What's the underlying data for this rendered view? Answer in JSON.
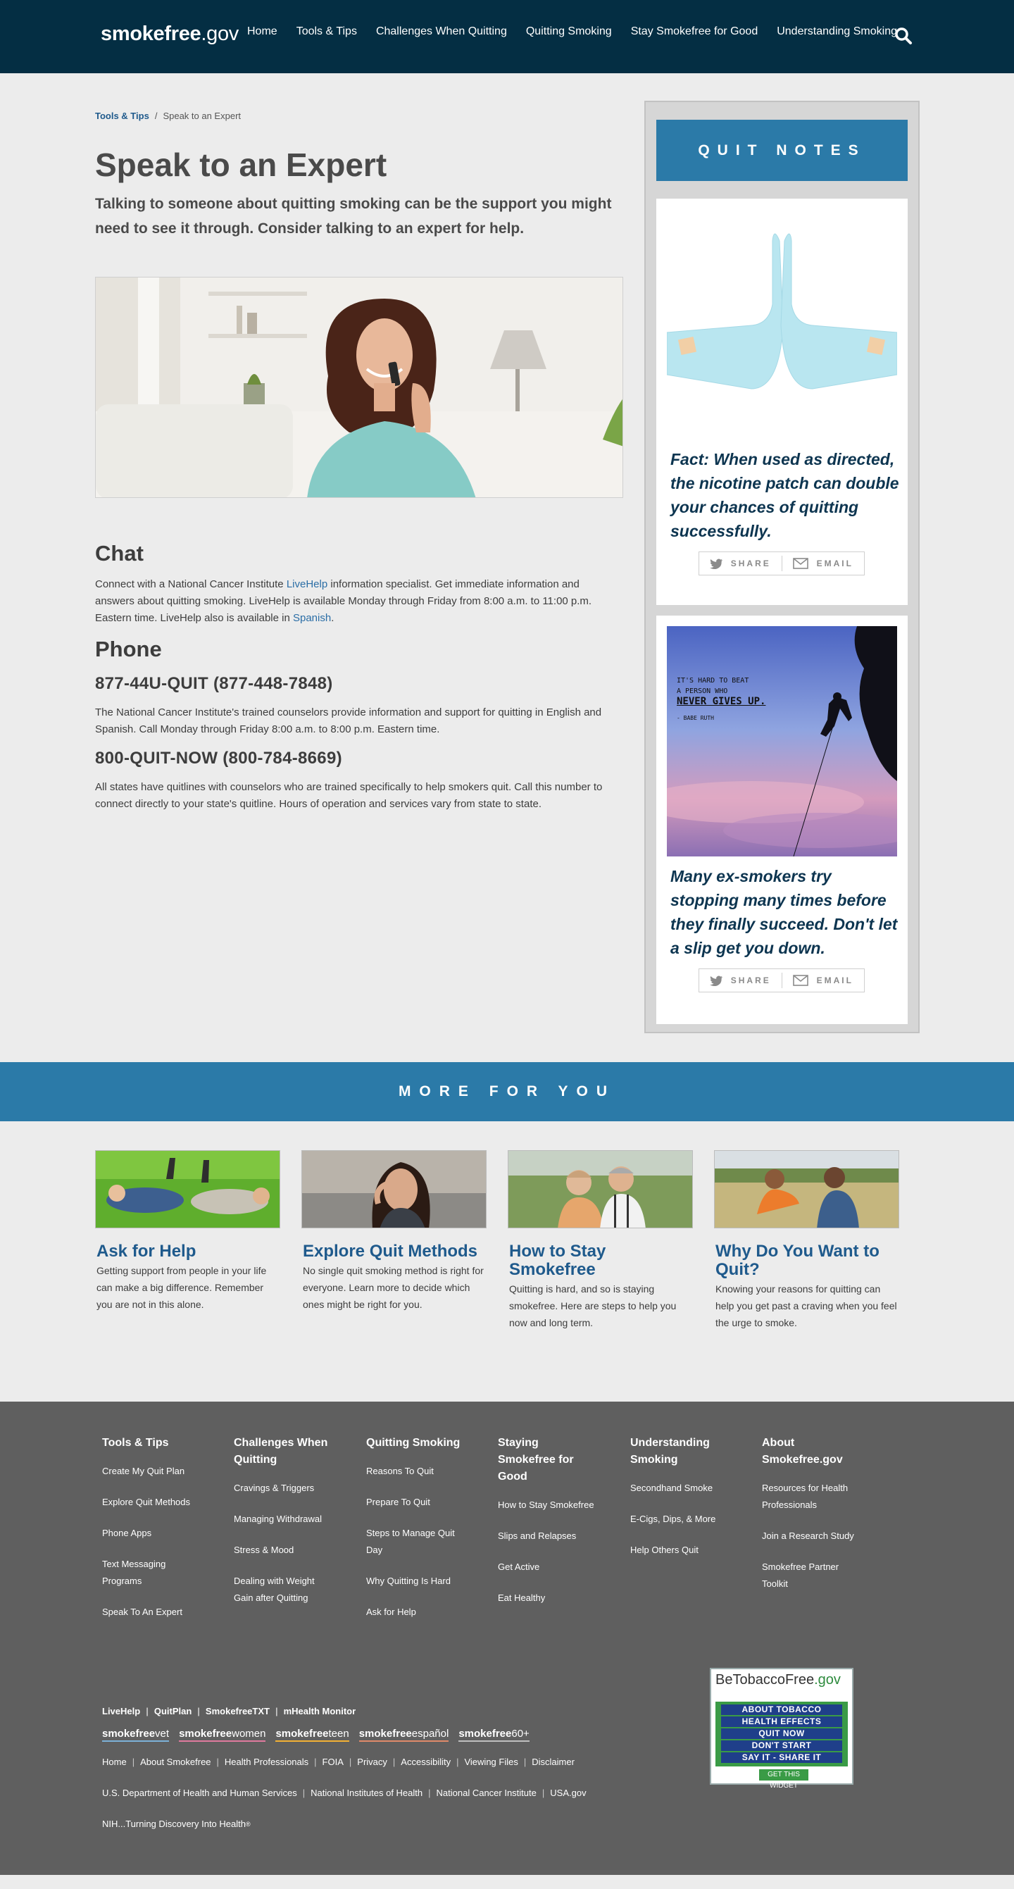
{
  "header": {
    "logo_main": "smokefree",
    "logo_suffix": ".gov",
    "nav": [
      "Home",
      "Tools & Tips",
      "Challenges When Quitting",
      "Quitting Smoking",
      "Stay Smokefree for Good",
      "Understanding Smoking"
    ]
  },
  "breadcrumb": {
    "parent": "Tools & Tips",
    "current": "Speak to an Expert"
  },
  "page": {
    "title": "Speak to an Expert",
    "lead": "Talking to someone about quitting smoking can be the support you might need to see it through. Consider talking to an expert for help."
  },
  "chat": {
    "heading": "Chat",
    "text1": "Connect with a National Cancer Institute ",
    "link1": "LiveHelp",
    "text2": " information specialist. Get immediate information and answers about quitting smoking. LiveHelp is available Monday through Friday from 8:00 a.m. to 11:00 p.m. Eastern time. LiveHelp also is available in ",
    "link2": "Spanish",
    "text3": "."
  },
  "phone": {
    "heading": "Phone",
    "number1": "877-44U-QUIT (877-448-7848)",
    "text1": "The National Cancer Institute's trained counselors provide information and support for quitting in English and Spanish. Call Monday through Friday 8:00 a.m. to 8:00 p.m. Eastern time.",
    "number2": "800-QUIT-NOW (800-784-8669)",
    "text2": "All states have quitlines with counselors who are trained specifically to help smokers quit. Call this number to connect directly to your state's quitline. Hours of operation and services vary from state to state."
  },
  "sidebar": {
    "heading": "QUIT NOTES",
    "notes": [
      {
        "text": "Fact: When used as directed, the nicotine patch can double your chances of quitting successfully."
      },
      {
        "text": "Many ex-smokers try stopping many times before they finally succeed. Don't let a slip get you down.",
        "image_quote": [
          "IT'S HARD TO BEAT",
          "A PERSON WHO",
          "NEVER GIVES UP.",
          "- BABE RUTH"
        ]
      }
    ],
    "share_label": "SHARE",
    "email_label": "EMAIL"
  },
  "more": {
    "heading": "MORE FOR YOU",
    "cards": [
      {
        "title": "Ask for Help",
        "text": "Getting support from people in your life can make a big difference. Remember you are not in this alone."
      },
      {
        "title": "Explore Quit Methods",
        "text": "No single quit smoking method is right for everyone. Learn more to decide which ones might be right for you."
      },
      {
        "title": "How to Stay Smokefree",
        "text": "Quitting is hard, and so is staying smokefree. Here are steps to help you now and long term."
      },
      {
        "title": "Why Do You Want to Quit?",
        "text": "Knowing your reasons for quitting can help you get past a craving when you feel the urge to smoke."
      }
    ]
  },
  "footer": {
    "columns": [
      {
        "heading": "Tools & Tips",
        "links": [
          "Create My Quit Plan",
          "Explore Quit Methods",
          "Phone Apps",
          "Text Messaging Programs",
          "Speak To An Expert"
        ]
      },
      {
        "heading": "Challenges When Quitting",
        "links": [
          "Cravings & Triggers",
          "Managing Withdrawal",
          "Stress & Mood",
          "Dealing with Weight Gain after Quitting"
        ]
      },
      {
        "heading": "Quitting Smoking",
        "links": [
          "Reasons To Quit",
          "Prepare To Quit",
          "Steps to Manage Quit Day",
          "Why Quitting Is Hard",
          "Ask for Help"
        ]
      },
      {
        "heading": "Staying Smokefree for Good",
        "links": [
          "How to Stay Smokefree",
          "Slips and Relapses",
          "Get Active",
          "Eat Healthy"
        ]
      },
      {
        "heading": "Understanding Smoking",
        "links": [
          "Secondhand Smoke",
          "E-Cigs, Dips, & More",
          "Help Others Quit"
        ]
      },
      {
        "heading": "About Smokefree.gov",
        "links": [
          "Resources for Health Professionals",
          "Join a Research Study",
          "Smokefree Partner Toolkit"
        ]
      }
    ],
    "programs": [
      "LiveHelp",
      "QuitPlan",
      "SmokefreeTXT",
      "mHealth Monitor"
    ],
    "brands": [
      {
        "main": "smokefree",
        "sub": "vet",
        "color": "#7db2d9"
      },
      {
        "main": "smokefree",
        "sub": "women",
        "color": "#e07a9e"
      },
      {
        "main": "smokefree",
        "sub": "teen",
        "color": "#f2b134"
      },
      {
        "main": "smokefree",
        "sub": "español",
        "color": "#e08a6a"
      },
      {
        "main": "smokefree",
        "sub": "60+",
        "color": "#bfbfbf"
      }
    ],
    "site_links": [
      "Home",
      "About Smokefree",
      "Health Professionals",
      "FOIA",
      "Privacy",
      "Accessibility",
      "Viewing Files",
      "Disclaimer"
    ],
    "gov_links": [
      "U.S. Department of Health and Human Services",
      "National Institutes of Health",
      "National Cancer Institute",
      "USA.gov"
    ],
    "nih_tagline": "NIH...Turning Discovery Into Health",
    "nih_mark": "®",
    "widget": {
      "title_main": "BeTobaccoFree",
      "title_suffix": ".gov",
      "items": [
        "ABOUT TOBACCO",
        "HEALTH EFFECTS",
        "QUIT NOW",
        "DON'T START",
        "SAY IT - SHARE IT"
      ],
      "button": "GET THIS WIDGET"
    }
  },
  "colors": {
    "header_bg": "#042e43",
    "accent_blue": "#2b7aa8",
    "link_blue": "#1f5a8c",
    "footer_bg": "#5f5f5f"
  }
}
